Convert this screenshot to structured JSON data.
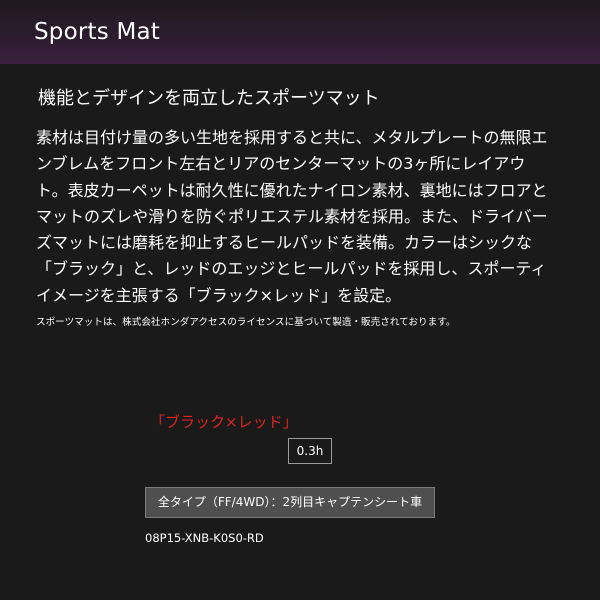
{
  "header": {
    "title": "Sports Mat"
  },
  "product": {
    "headline": "機能とデザインを両立したスポーツマット",
    "description_lines": [
      "素材は目付け量の多い生地を採用すると共に、メタルプレートの無限エ",
      "ンブレムをフロント左右とリアのセンターマットの3ヶ所にレイアウ",
      "ト。表皮カーペットは耐久性に優れたナイロン素材、裏地にはフロアと",
      "マットのズレや滑りを防ぐポリエステル素材を採用。また、ドライバー",
      "ズマットには磨耗を抑止するヒールパッドを装備。カラーはシックな",
      "「ブラック」と、レッドのエッジとヒールパッドを採用し、スポーティ",
      "イメージを主張する「ブラック×レッド」を設定。"
    ],
    "license_note": "スポーツマットは、株式会社ホンダアクセスのライセンスに基づいて製造・販売されております。",
    "variant_label": "「ブラック×レッド」",
    "variant_color": "#e0231d",
    "work_time": "0.3h",
    "type_button_label": "全タイプ（FF/4WD）：2列目キャプテンシート車",
    "part_number": "08P15-XNB-K0S0-RD"
  }
}
